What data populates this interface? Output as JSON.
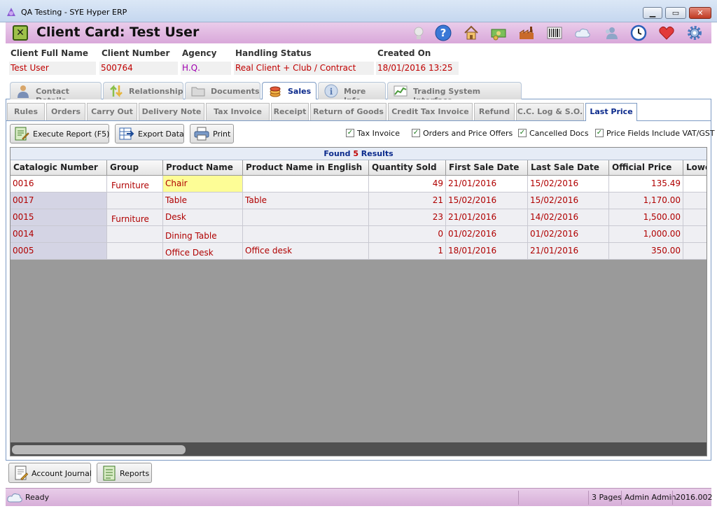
{
  "window": {
    "title": "QA Testing - SYE Hyper ERP"
  },
  "card": {
    "title": "Client Card: Test User"
  },
  "header_icons": [
    "lightbulb-icon",
    "help-icon",
    "home-icon",
    "money-icon",
    "factory-icon",
    "barcode-icon",
    "cloud-icon",
    "users-icon",
    "clock-icon",
    "heart-icon",
    "gear-icon"
  ],
  "client": {
    "full_name_label": "Client Full Name",
    "full_name": "Test User",
    "number_label": "Client Number",
    "number": "500764",
    "agency_label": "Agency",
    "agency": "H.Q.",
    "status_label": "Handling Status",
    "status": "Real Client + Club / Contract",
    "created_label": "Created On",
    "created": "18/01/2016 13:25"
  },
  "tabs": [
    "Contact Details",
    "Relationship",
    "Documents",
    "Sales",
    "More Info",
    "Trading System Interface"
  ],
  "active_tab": "Sales",
  "subtabs": [
    "Rules",
    "Orders",
    "Carry Out",
    "Delivery Note",
    "Tax Invoice",
    "Receipt",
    "Return of Goods",
    "Credit Tax Invoice",
    "Refund",
    "C.C. Log & S.O.",
    "Last Price"
  ],
  "active_subtab": "Last Price",
  "toolbar": {
    "execute": "Execute Report  (F5)",
    "export": "Export Data",
    "print": "Print"
  },
  "filters": [
    {
      "label": "Tax Invoice",
      "checked": true
    },
    {
      "label": "Orders and Price Offers",
      "checked": true
    },
    {
      "label": "Cancelled Docs",
      "checked": true
    },
    {
      "label": "Price Fields Include VAT/GST",
      "checked": true
    }
  ],
  "results": {
    "prefix": "Found ",
    "count": "5",
    "suffix": " Results"
  },
  "grid": {
    "columns": [
      "Catalogic Number",
      "Group",
      "Product Name",
      "Product Name in English",
      "Quantity Sold",
      "First Sale Date",
      "Last Sale Date",
      "Official Price",
      "Lowe"
    ],
    "rows": [
      [
        "0016",
        "Furniture",
        "Chair",
        "",
        "49",
        "21/01/2016",
        "15/02/2016",
        "135.49",
        ""
      ],
      [
        "0017",
        "",
        "Table",
        "Table",
        "21",
        "15/02/2016",
        "15/02/2016",
        "1,170.00",
        ""
      ],
      [
        "0015",
        "Furniture",
        "Desk",
        "",
        "23",
        "21/01/2016",
        "14/02/2016",
        "1,500.00",
        ""
      ],
      [
        "0014",
        "",
        "Dining Table",
        "",
        "0",
        "01/02/2016",
        "01/02/2016",
        "1,000.00",
        ""
      ],
      [
        "0005",
        "",
        "Office Desk",
        "Office desk",
        "1",
        "18/01/2016",
        "21/01/2016",
        "350.00",
        ""
      ]
    ]
  },
  "footer": {
    "journal": "Account Journal",
    "reports": "Reports"
  },
  "status": {
    "text": "Ready",
    "pages": "3 Pages",
    "user": "Admin Admin",
    "version": "2016.002"
  },
  "colors": {
    "accent": "#0b2a8c",
    "value_red": "#c00000",
    "header_pink": "#d9a8da",
    "highlight": "#fdfd96"
  }
}
